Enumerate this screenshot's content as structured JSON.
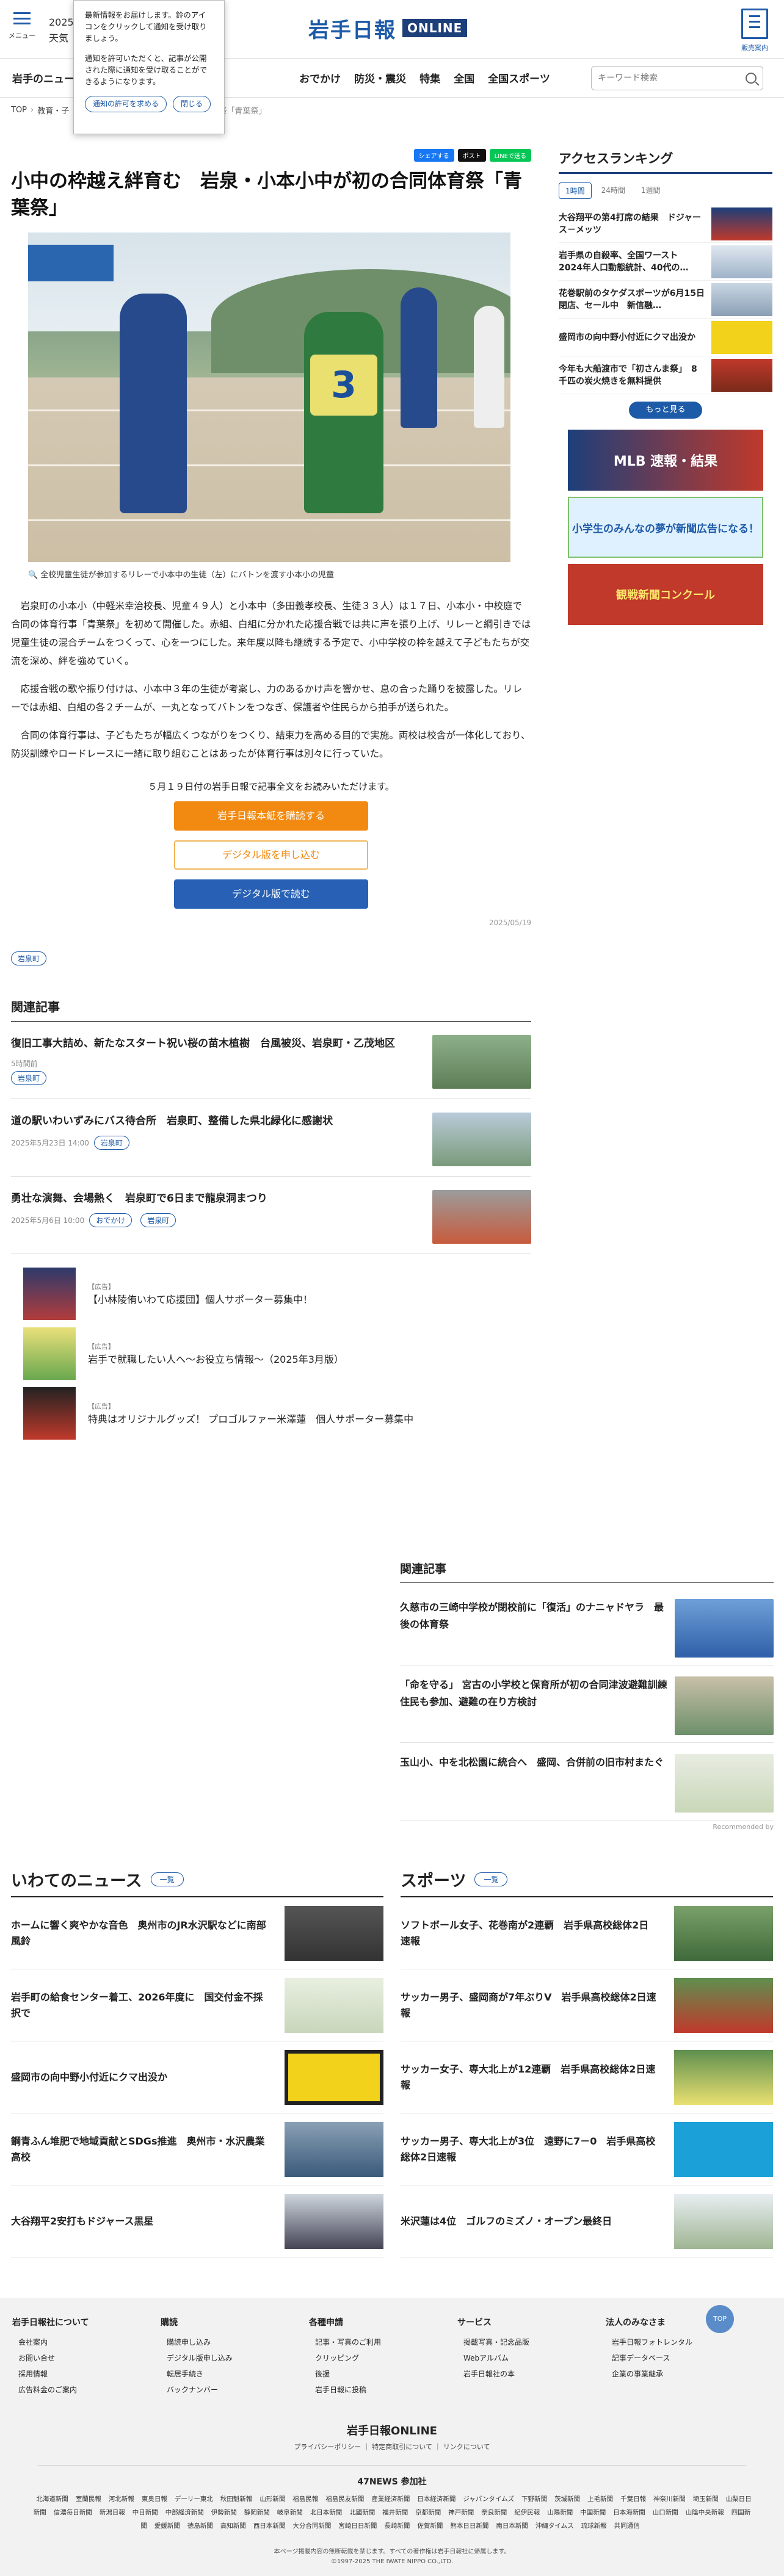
{
  "header": {
    "menu": "メニュー",
    "date": "2025",
    "weather": "天気",
    "logo_jp": "岩手日報",
    "logo_online": "ONLINE",
    "guide": "販売案内"
  },
  "nav": {
    "items": [
      "岩手のニュース",
      "おでかけ",
      "防災・震災",
      "特集",
      "全国",
      "全国スポーツ"
    ],
    "search_placeholder": "キーワード検索"
  },
  "breadcrumb": {
    "items": [
      "TOP",
      "教育・子"
    ],
    "current": "合同体育祭「青葉祭」"
  },
  "notification": {
    "p1": "最新情報をお届けします。鈴のアイコンをクリックして通知を受け取りましょう。",
    "p2": "通知を許可いただくと、記事が公開された際に通知を受け取ることができるようになります。",
    "allow": "通知の許可を求める",
    "close": "閉じる"
  },
  "share": {
    "fb": "シェアする",
    "x": "ポスト",
    "line": "LINEで送る"
  },
  "article": {
    "title": "小中の枠越え絆育む　岩泉・小本小中が初の合同体育祭「青葉祭」",
    "bib": "3",
    "caption": "全校児童生徒が参加するリレーで小本中の生徒（左）にバトンを渡す小本小の児童",
    "paragraphs": [
      "岩泉町の小本小（中軽米幸治校長、児童４９人）と小本中（多田義孝校長、生徒３３人）は１７日、小本小・中校庭で合同の体育行事「青葉祭」を初めて開催した。赤組、白組に分かれた応援合戦では共に声を張り上げ、リレーと綱引きでは児童生徒の混合チームをつくって、心を一つにした。来年度以降も継続する予定で、小中学校の枠を越えて子どもたちが交流を深め、絆を強めていく。",
      "応援合戦の歌や振り付けは、小本中３年の生徒が考案し、力のあるかけ声を響かせ、息の合った踊りを披露した。リレーでは赤組、白組の各２チームが、一丸となってバトンをつなぎ、保護者や住民らから拍手が送られた。",
      "合同の体育行事は、子どもたちが幅広くつながりをつくり、結束力を高める目的で実施。両校は校舎が一体化しており、防災訓練やロードレースに一緒に取り組むことはあったが体育行事は別々に行っていた。"
    ],
    "readmore": "５月１９日付の岩手日報で記事全文をお読みいただけます。",
    "cta1": "岩手日報本紙を購読する",
    "cta2": "デジタル版を申し込む",
    "cta3": "デジタル版で読む",
    "date": "2025/05/19",
    "tag": "岩泉町"
  },
  "related": {
    "heading": "関連記事",
    "items": [
      {
        "title": "復旧工事大詰め、新たなスタート祝い桜の苗木植樹　台風被災、岩泉町・乙茂地区",
        "time": "5時間前",
        "tags": [
          "岩泉町"
        ]
      },
      {
        "title": "道の駅いわいずみにバス待合所　岩泉町、整備した県北緑化に感謝状",
        "time": "2025年5月23日 14:00",
        "tags": [
          "岩泉町"
        ]
      },
      {
        "title": "勇壮な演舞、会場熱く　岩泉町で6日まで龍泉洞まつり",
        "time": "2025年5月6日 10:00",
        "tags": [
          "おでかけ",
          "岩泉町"
        ]
      }
    ]
  },
  "ads": [
    {
      "label": "【広告】",
      "title": "【小林陵侑いわて応援団】個人サポーター募集中！"
    },
    {
      "label": "【広告】",
      "title": "岩手で就職したい人へ〜お役立ち情報〜（2025年3月版）"
    },
    {
      "label": "【広告】",
      "title": "特典はオリジナルグッズ！ プロゴルファー米澤蓮　個人サポーター募集中"
    }
  ],
  "ranking": {
    "heading": "アクセスランキング",
    "tabs": [
      "1時間",
      "24時間",
      "1週間"
    ],
    "items": [
      "大谷翔平の第4打席の結果　ドジャース－メッツ",
      "岩手県の自殺率、全国ワースト　2024年人口動態統計、40代の…",
      "花巻駅前のタケダスポーツが6月15日閉店、セール中　新信融…",
      "盛岡市の向中野小付近にクマ出没か",
      "今年も大船渡市で「初さんま祭」　8千匹の炭火焼きを無料提供"
    ],
    "more": "もっと見る"
  },
  "banners": [
    "MLB 速報・結果",
    "小学生のみんなの夢が新聞広告になる！",
    "観戦新聞コンクール"
  ],
  "related2": {
    "heading": "関連記事",
    "items": [
      "久慈市の三崎中学校が閉校前に「復活」のナニャドヤラ　最後の体育祭",
      "「命を守る」 宮古の小学校と保育所が初の合同津波避難訓練　住民も参加、避難の在り方検討",
      "玉山小、中を北松園に統合へ　盛岡、合併前の旧市村またぐ"
    ],
    "recommended": "Recommended by"
  },
  "iwate_news": {
    "heading": "いわてのニュース",
    "more": "一覧",
    "items": [
      "ホームに響く爽やかな音色　奥州市のJR水沢駅などに南部風鈴",
      "岩手町の給食センター着工、2026年度に　国交付金不採択で",
      "盛岡市の向中野小付近にクマ出没か",
      "鋼青ふん堆肥で地域貢献とSDGs推進　奥州市・水沢農業高校",
      "大谷翔平2安打もドジャース黒星"
    ]
  },
  "sports": {
    "heading": "スポーツ",
    "more": "一覧",
    "items": [
      "ソフトボール女子、花巻南が2連覇　岩手県高校総体2日速報",
      "サッカー男子、盛岡商が7年ぶりV　岩手県高校総体2日速報",
      "サッカー女子、専大北上が12連覇　岩手県高校総体2日速報",
      "サッカー男子、専大北上が3位　遠野に7－0　岩手県高校総体2日速報",
      "米沢蓮は4位　ゴルフのミズノ・オープン最終日"
    ]
  },
  "footer": {
    "cols": [
      {
        "h": "岩手日報社について",
        "items": [
          "会社案内",
          "お問い合せ",
          "採用情報",
          "広告料金のご案内"
        ]
      },
      {
        "h": "購読",
        "items": [
          "購読申し込み",
          "デジタル版申し込み",
          "転居手続き",
          "バックナンバー"
        ]
      },
      {
        "h": "各種申請",
        "items": [
          "記事・写真のご利用",
          "クリッピング",
          "後援",
          "岩手日報に投稿"
        ]
      },
      {
        "h": "サービス",
        "items": [
          "掲載写真・記念品販",
          "Webアルバム",
          "岩手日報社の本"
        ]
      },
      {
        "h": "法人のみなさま",
        "items": [
          "岩手日報フォトレンタル",
          "記事データベース",
          "企業の事業継承"
        ]
      }
    ],
    "brand": "岩手日報ONLINE",
    "legal": "プライバシーポリシー ｜ 特定商取引について ｜ リンクについて",
    "n47": "47NEWS 参加社",
    "papers": [
      "北海道新聞",
      "室蘭民報",
      "河北新報",
      "東奥日報",
      "デーリー東北",
      "秋田魁新報",
      "山形新聞",
      "福島民報",
      "福島民友新聞",
      "産業経済新聞",
      "日本経済新聞",
      "ジャパンタイムズ",
      "下野新聞",
      "茨城新聞",
      "上毛新聞",
      "千葉日報",
      "神奈川新聞",
      "埼玉新聞",
      "山梨日日新聞",
      "信濃毎日新聞",
      "新潟日報",
      "中日新聞",
      "中部経済新聞",
      "伊勢新聞",
      "静岡新聞",
      "岐阜新聞",
      "北日本新聞",
      "北國新聞",
      "福井新聞",
      "京都新聞",
      "神戸新聞",
      "奈良新聞",
      "紀伊民報",
      "山陽新聞",
      "中国新聞",
      "日本海新聞",
      "山口新聞",
      "山陰中央新報",
      "四国新聞",
      "愛媛新聞",
      "徳島新聞",
      "高知新聞",
      "西日本新聞",
      "大分合同新聞",
      "宮崎日日新聞",
      "長崎新聞",
      "佐賀新聞",
      "熊本日日新聞",
      "南日本新聞",
      "沖縄タイムス",
      "琉球新報",
      "共同通信"
    ],
    "copy1": "本ページ掲載内容の無断転載を禁じます。すべての著作権は岩手日報社に帰属します。",
    "copy2": "©1997-2025 THE IWATE NIPPO CO.,LTD.",
    "top": "TOP"
  }
}
